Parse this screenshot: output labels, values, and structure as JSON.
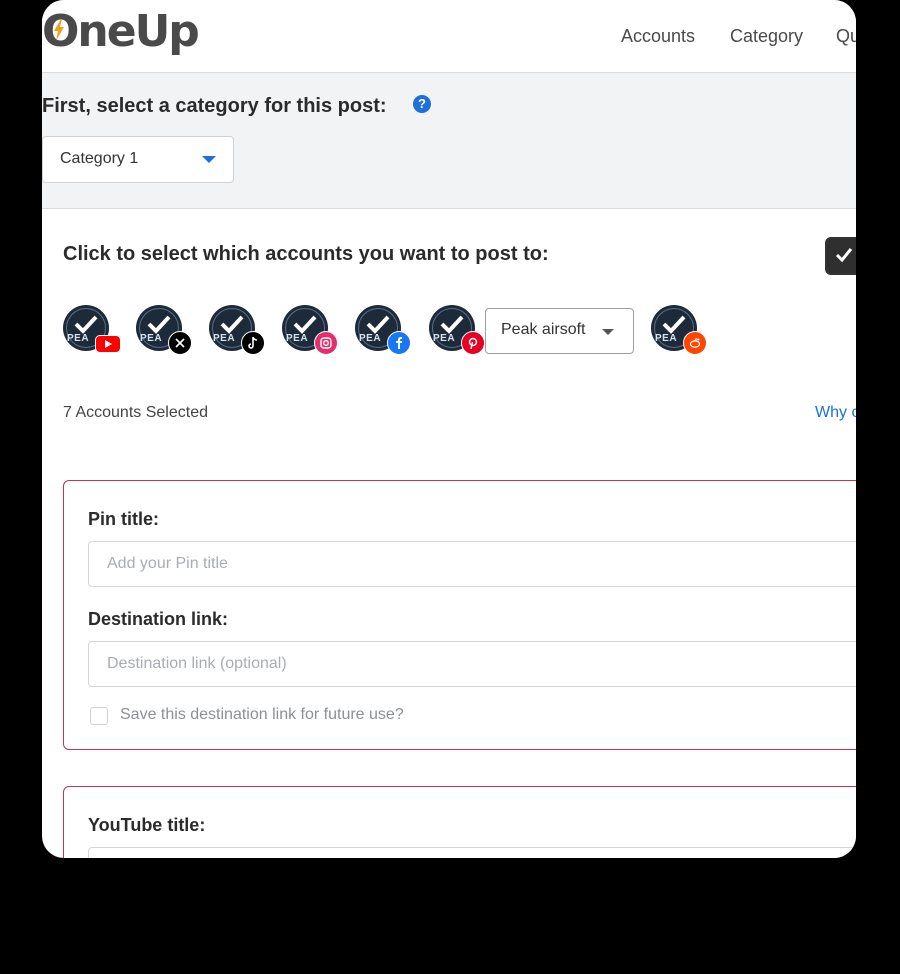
{
  "header": {
    "logo": "OneUp",
    "nav": [
      "Accounts",
      "Category",
      "Qu"
    ]
  },
  "category": {
    "title": "First, select a category for this post:",
    "help": "?",
    "selected": "Category 1"
  },
  "accounts": {
    "title": "Click to select which accounts you want to post to:",
    "avatar_text": "PEA",
    "items": [
      {
        "network": "youtube",
        "badge_color": "#ff0000",
        "icon": "youtube-icon"
      },
      {
        "network": "x",
        "badge_color": "#000000",
        "icon": "x-icon"
      },
      {
        "network": "tiktok",
        "badge_color": "#000000",
        "icon": "tiktok-icon"
      },
      {
        "network": "instagram",
        "badge_color": "#e1306c",
        "icon": "instagram-icon"
      },
      {
        "network": "facebook",
        "badge_color": "#1877f2",
        "icon": "facebook-icon"
      },
      {
        "network": "pinterest",
        "badge_color": "#e60023",
        "icon": "pinterest-icon"
      },
      {
        "network": "reddit",
        "badge_color": "#ff4500",
        "icon": "reddit-icon"
      }
    ],
    "board_select": "Peak airsoft",
    "selected_count": "7 Accounts Selected",
    "why_link": "Why c"
  },
  "pinterest_card": {
    "pin_title_label": "Pin title:",
    "pin_title_placeholder": "Add your Pin title",
    "pin_title_value": "",
    "destination_label": "Destination link:",
    "destination_placeholder": "Destination link (optional)",
    "destination_value": "",
    "save_link_label": "Save this destination link for future use?",
    "save_link_checked": false
  },
  "youtube_card": {
    "title_label": "YouTube title:"
  },
  "colors": {
    "accent": "#1e6fd9",
    "card_border": "#c8334f",
    "band_bg": "#f2f3f4"
  }
}
